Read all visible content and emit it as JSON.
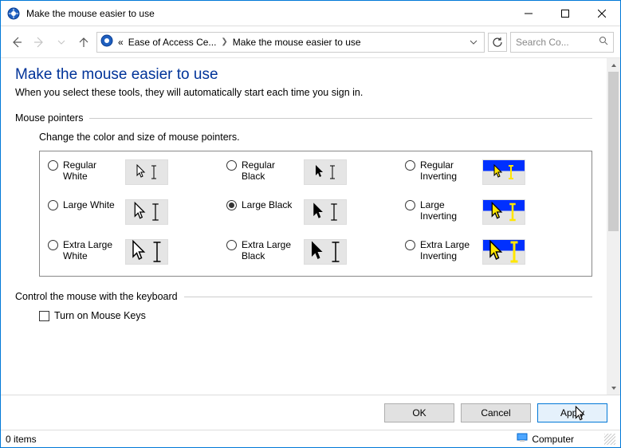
{
  "window": {
    "title": "Make the mouse easier to use"
  },
  "breadcrumb": {
    "segment1": "Ease of Access Ce...",
    "segment2": "Make the mouse easier to use"
  },
  "search": {
    "placeholder": "Search Co..."
  },
  "page": {
    "title": "Make the mouse easier to use",
    "subtitle": "When you select these tools, they will automatically start each time you sign in."
  },
  "section1": {
    "header": "Mouse pointers",
    "description": "Change the color and size of mouse pointers."
  },
  "pointers": {
    "r1c1": "Regular White",
    "r1c2": "Regular Black",
    "r1c3": "Regular Inverting",
    "r2c1": "Large White",
    "r2c2": "Large Black",
    "r2c3": "Large Inverting",
    "r3c1": "Extra Large White",
    "r3c2": "Extra Large Black",
    "r3c3": "Extra Large Inverting",
    "selected": "r2c2"
  },
  "section2": {
    "header": "Control the mouse with the keyboard",
    "checkbox": "Turn on Mouse Keys"
  },
  "buttons": {
    "ok": "OK",
    "cancel": "Cancel",
    "apply": "Apply"
  },
  "status": {
    "items": "0 items",
    "location": "Computer"
  }
}
